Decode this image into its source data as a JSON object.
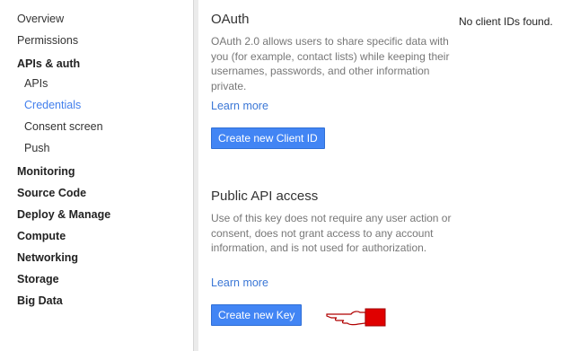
{
  "sidebar": {
    "items": [
      {
        "label": "Overview"
      },
      {
        "label": "Permissions"
      },
      {
        "label": "APIs & auth"
      },
      {
        "label": "APIs"
      },
      {
        "label": "Credentials"
      },
      {
        "label": "Consent screen"
      },
      {
        "label": "Push"
      },
      {
        "label": "Monitoring"
      },
      {
        "label": "Source Code"
      },
      {
        "label": "Deploy & Manage"
      },
      {
        "label": "Compute"
      },
      {
        "label": "Networking"
      },
      {
        "label": "Storage"
      },
      {
        "label": "Big Data"
      }
    ],
    "selected_item": "Credentials"
  },
  "oauth": {
    "title": "OAuth",
    "description": "OAuth 2.0 allows users to share specific data with you (for example, contact lists) while keeping their usernames, passwords, and other information private.",
    "learn_more": "Learn more",
    "button_label": "Create new Client ID"
  },
  "public_api": {
    "title": "Public API access",
    "description": "Use of this key does not require any user action or consent, does not grant access to any account information, and is not used for authorization.",
    "learn_more": "Learn more",
    "button_label": "Create new Key"
  },
  "client_ids": {
    "status": "No client IDs found."
  },
  "colors": {
    "accent": "#4285f4",
    "link": "#3b77d6",
    "pointer": "#e00000"
  },
  "icons": {
    "pointer": "pointing-hand-icon"
  }
}
